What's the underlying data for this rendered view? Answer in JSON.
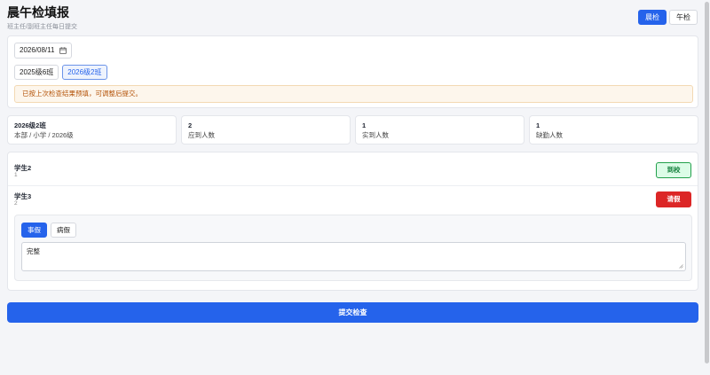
{
  "header": {
    "title": "晨午检填报",
    "subtitle": "班主任/副班主任每日提交",
    "modes": [
      {
        "label": "晨检",
        "active": true
      },
      {
        "label": "午检",
        "active": false
      }
    ]
  },
  "filters": {
    "date": "2026/08/11",
    "date_icon": "calendar-icon",
    "classes": [
      {
        "label": "2025级6班",
        "active": false
      },
      {
        "label": "2026级2班",
        "active": true
      }
    ],
    "notice": "已按上次检查结果预填，可调整后提交。"
  },
  "summary": [
    {
      "value": "2026级2班",
      "label": "本部 / 小学 / 2026级"
    },
    {
      "value": "2",
      "label": "应到人数"
    },
    {
      "value": "1",
      "label": "实到人数"
    },
    {
      "value": "1",
      "label": "缺勤人数"
    }
  ],
  "students": [
    {
      "name": "学生2",
      "number": "1",
      "status": "到校"
    },
    {
      "name": "学生3",
      "number": "2",
      "status": "请假"
    }
  ],
  "leave": {
    "types": [
      {
        "label": "事假",
        "active": true
      },
      {
        "label": "病假",
        "active": false
      }
    ],
    "note": "完整"
  },
  "submit_label": "提交检查",
  "colors": {
    "primary": "#2563eb",
    "present": "#15803d",
    "leave": "#dc2626",
    "notice": "#b45309"
  }
}
